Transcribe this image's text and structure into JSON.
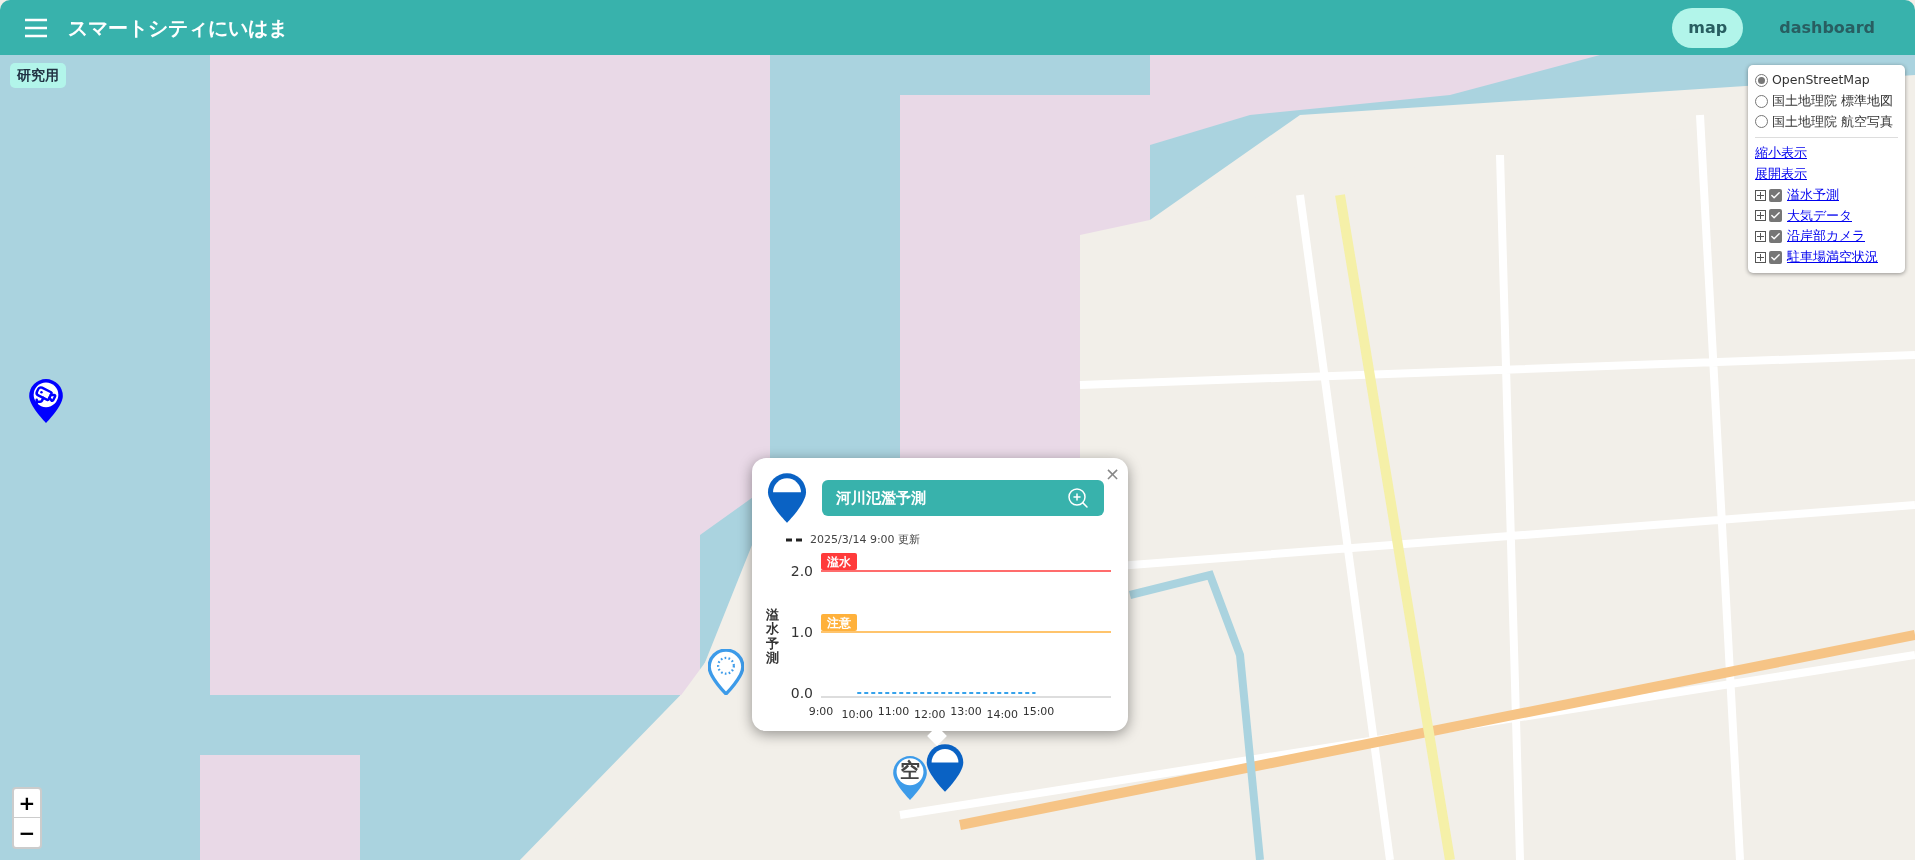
{
  "header": {
    "title": "スマートシティにいはま",
    "tabs": [
      {
        "label": "map",
        "selected": true
      },
      {
        "label": "dashboard",
        "selected": false
      }
    ]
  },
  "badge": "研究用",
  "layer_control": {
    "base_layers": [
      {
        "label": "OpenStreetMap",
        "selected": true
      },
      {
        "label": "国土地理院 標準地図",
        "selected": false
      },
      {
        "label": "国土地理院 航空写真",
        "selected": false
      }
    ],
    "links": [
      "縮小表示",
      "展開表示"
    ],
    "overlays": [
      {
        "label": "溢水予測",
        "checked": true
      },
      {
        "label": "大気データ",
        "checked": true
      },
      {
        "label": "沿岸部カメラ",
        "checked": true
      },
      {
        "label": "駐車場満空状況",
        "checked": true
      }
    ]
  },
  "markers": [
    {
      "kind": "camera"
    },
    {
      "kind": "pending"
    },
    {
      "kind": "parking",
      "label": "空"
    },
    {
      "kind": "water"
    }
  ],
  "popup": {
    "title": "河川氾濫予測",
    "close": "×",
    "chart_data": {
      "type": "line",
      "ylabel": "溢水予測",
      "categories": [
        "9:00",
        "10:00",
        "11:00",
        "12:00",
        "13:00",
        "14:00",
        "15:00"
      ],
      "ylim": [
        0,
        2
      ],
      "yticks": [
        {
          "value": 0,
          "label": "0.0"
        },
        {
          "value": 1,
          "label": "1.0"
        },
        {
          "value": 2,
          "label": "2.0"
        }
      ],
      "series": [
        {
          "name": "2025/3/14 9:00 更新",
          "color": "#36a2eb",
          "line_style": "dashed",
          "values": [
            null,
            0,
            0,
            0,
            0,
            0,
            0
          ]
        },
        {
          "name": "溢水",
          "color": "#ff3b3b",
          "values": [
            2,
            2,
            2,
            2,
            2,
            2,
            2
          ]
        },
        {
          "name": "注意",
          "color": "#ffb13b",
          "values": [
            1,
            1,
            1,
            1,
            1,
            1,
            1
          ]
        }
      ]
    }
  },
  "zoom": {
    "in": "+",
    "out": "−"
  }
}
